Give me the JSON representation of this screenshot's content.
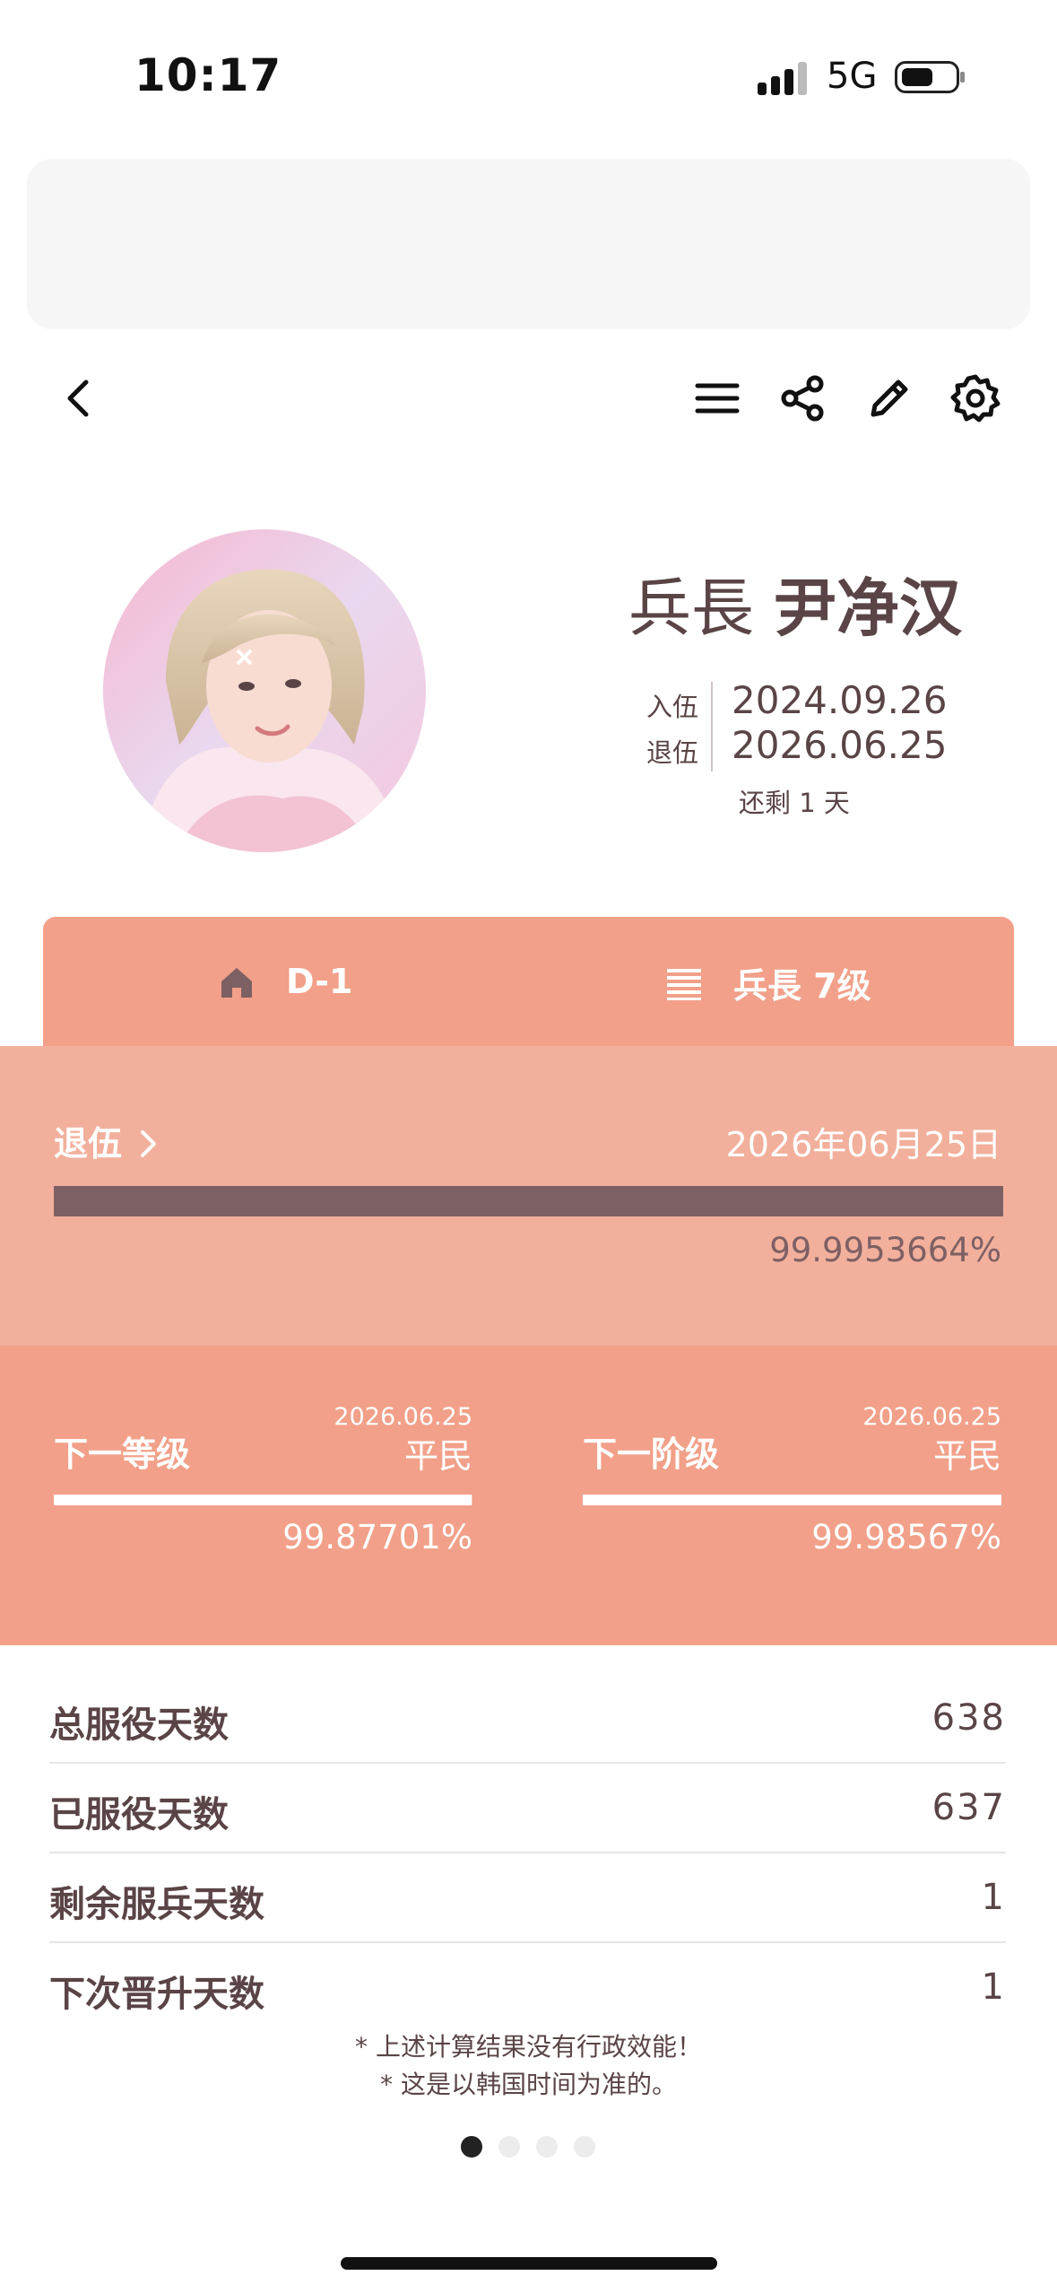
{
  "status_bar": {
    "time": "10:17",
    "network": "5G",
    "battery_level": 0.55
  },
  "toolbar": {
    "back_icon": "chevron-left-icon",
    "menu_icon": "hamburger-menu-icon",
    "share_icon": "share-icon",
    "edit_icon": "pencil-icon",
    "settings_icon": "gear-icon"
  },
  "profile": {
    "rank": "兵長",
    "name": "尹净汉",
    "enlist_label": "入伍",
    "enlist_date": "2024.09.26",
    "discharge_label": "退伍",
    "discharge_date": "2026.06.25",
    "remaining_text": "还剩 1 天"
  },
  "tabs": [
    {
      "icon": "home-icon",
      "label": "D-1"
    },
    {
      "icon": "list-icon",
      "label": "兵長 7级"
    }
  ],
  "discharge": {
    "label": "退伍",
    "date": "2026年06月25日",
    "progress_text": "99.9953664%",
    "progress": 0.999953664
  },
  "next": {
    "grade": {
      "label": "下一等级",
      "date": "2026.06.25",
      "target": "平民",
      "progress_text": "99.87701%",
      "progress": 0.9987701
    },
    "stage": {
      "label": "下一阶级",
      "date": "2026.06.25",
      "target": "平民",
      "progress_text": "99.98567%",
      "progress": 0.9998567
    }
  },
  "stats": [
    {
      "label": "总服役天数",
      "value": "638"
    },
    {
      "label": "已服役天数",
      "value": "637"
    },
    {
      "label": "剩余服兵天数",
      "value": "1"
    },
    {
      "label": "下次晋升天数",
      "value": "1"
    }
  ],
  "notes": [
    "* 上述计算结果没有行政效能！",
    "* 这是以韩国时间为准的。"
  ],
  "pagination": {
    "count": 4,
    "active": 0
  },
  "colors": {
    "accent": "#f2a089",
    "accent_light": "#f2b09c",
    "progress_dark": "#7d6064",
    "text": "#5a4446"
  }
}
